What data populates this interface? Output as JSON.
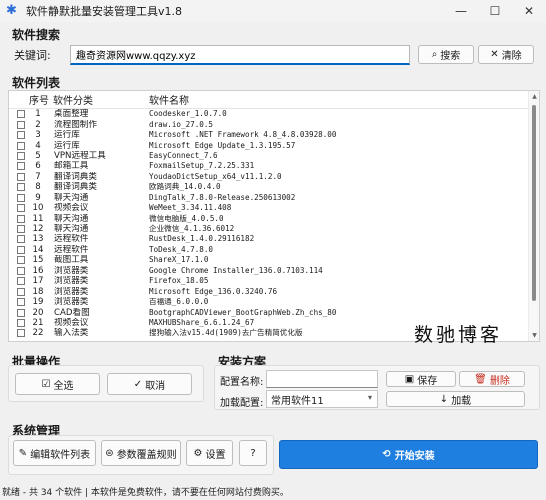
{
  "window": {
    "title": "软件静默批量安装管理工具v1.8",
    "min_label": "—",
    "max_label": "☐",
    "close_label": "✕"
  },
  "search": {
    "section_title": "软件搜索",
    "keyword_label": "关键词:",
    "query_value": "趣奇资源网www.qqzy.xyz",
    "search_button": "搜索",
    "clear_button": "清除"
  },
  "software_list": {
    "section_title": "软件列表",
    "columns": {
      "no": "序号",
      "category": "软件分类",
      "name": "软件名称"
    },
    "rows": [
      {
        "no": "1",
        "category": "桌面整理",
        "name": "Coodesker_1.0.7.0"
      },
      {
        "no": "2",
        "category": "流程图制作",
        "name": "draw.io_27.0.5"
      },
      {
        "no": "3",
        "category": "运行库",
        "name": "Microsoft .NET Framework 4.8_4.8.03928.00"
      },
      {
        "no": "4",
        "category": "运行库",
        "name": "Microsoft Edge Update_1.3.195.57"
      },
      {
        "no": "5",
        "category": "VPN远程工具",
        "name": "EasyConnect_7.6"
      },
      {
        "no": "6",
        "category": "邮箱工具",
        "name": "FoxmailSetup_7.2.25.331"
      },
      {
        "no": "7",
        "category": "翻译词典类",
        "name": "YoudaoDictSetup_x64_v11.1.2.0"
      },
      {
        "no": "8",
        "category": "翻译词典类",
        "name": "欧路词典_14.0.4.0"
      },
      {
        "no": "9",
        "category": "聊天沟通",
        "name": "DingTalk_7.8.0-Release.250613002"
      },
      {
        "no": "10",
        "category": "视频会议",
        "name": "WeMeet_3.34.11.408"
      },
      {
        "no": "11",
        "category": "聊天沟通",
        "name": "微信电脑版_4.0.5.0"
      },
      {
        "no": "12",
        "category": "聊天沟通",
        "name": "企业微信_4.1.36.6012"
      },
      {
        "no": "13",
        "category": "远程软件",
        "name": "RustDesk_1.4.0.29116182"
      },
      {
        "no": "14",
        "category": "远程软件",
        "name": "ToDesk_4.7.8.0"
      },
      {
        "no": "15",
        "category": "截图工具",
        "name": "ShareX_17.1.0"
      },
      {
        "no": "16",
        "category": "浏览器类",
        "name": "Google Chrome Installer_136.0.7103.114"
      },
      {
        "no": "17",
        "category": "浏览器类",
        "name": "Firefox_18.05"
      },
      {
        "no": "18",
        "category": "浏览器类",
        "name": "Microsoft Edge_136.0.3240.76"
      },
      {
        "no": "19",
        "category": "浏览器类",
        "name": "百福通_6.0.0.0"
      },
      {
        "no": "20",
        "category": "CAD看图",
        "name": "BootgraphCADViewer_BootGraphWeb.Zh_chs_80"
      },
      {
        "no": "21",
        "category": "视频会议",
        "name": "MAXHUBShare_6.6.1.24_67"
      },
      {
        "no": "22",
        "category": "输入法类",
        "name": "搜狗输入法v15.4d(1909)去广告精简优化版"
      }
    ]
  },
  "watermark": "数驰博客",
  "batch": {
    "section_title": "批量操作",
    "select_all": "全选",
    "cancel": "取消"
  },
  "install_plan": {
    "section_title": "安装方案",
    "config_name_label": "配置名称:",
    "config_name_value": "",
    "load_config_label": "加载配置:",
    "load_config_value": "常用软件11",
    "save_button": "保存",
    "delete_button": "删除",
    "load_button": "加载"
  },
  "system": {
    "section_title": "系统管理",
    "edit_list": "编辑软件列表",
    "param_rules": "参数覆盖规则",
    "settings": "设置",
    "help": "?",
    "start_install": "开始安装"
  },
  "status": {
    "text": "就绪 - 共 34 个软件 | 本软件是免费软件，请不要在任何网站付费购买。"
  },
  "colors": {
    "accent": "#1e7fe0",
    "danger": "#c42b1c"
  }
}
